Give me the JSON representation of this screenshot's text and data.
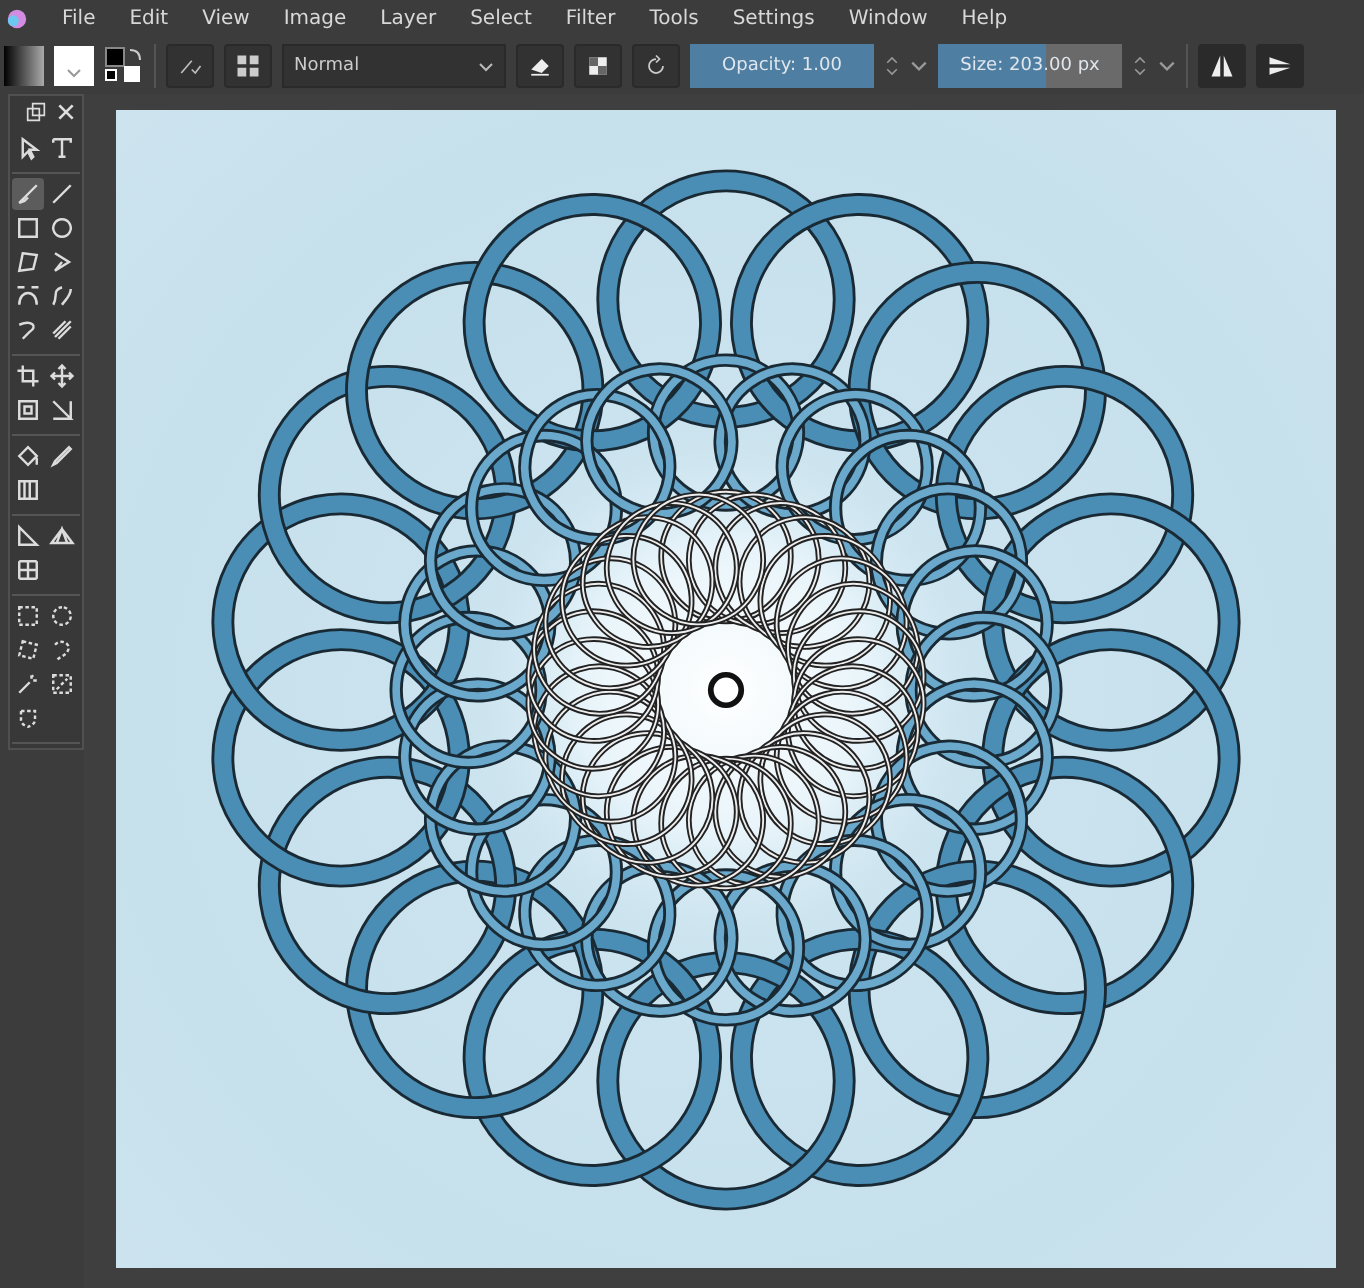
{
  "menu_bar": {
    "menus": [
      "File",
      "Edit",
      "View",
      "Image",
      "Layer",
      "Select",
      "Filter",
      "Tools",
      "Settings",
      "Window",
      "Help"
    ]
  },
  "toolbar": {
    "blend_mode": "Normal",
    "opacity": {
      "text": "Opacity:  1.00",
      "level": 1.0
    },
    "size": {
      "text": "Size:  203.00 px",
      "level": 0.59
    },
    "mirror_horizontal": {
      "on": false
    },
    "mirror_vertical": {
      "on": false
    }
  },
  "toolbox": {
    "groups": [
      [
        {
          "kind": "select",
          "selected": false
        },
        {
          "kind": "text",
          "selected": false
        }
      ],
      [
        {
          "kind": "brush",
          "selected": true
        },
        {
          "kind": "line",
          "selected": false
        },
        {
          "kind": "rect",
          "selected": false
        },
        {
          "kind": "ellipse",
          "selected": false
        },
        {
          "kind": "polygon",
          "selected": false
        },
        {
          "kind": "polyline",
          "selected": false
        },
        {
          "kind": "bezier",
          "selected": false
        },
        {
          "kind": "freepath",
          "selected": false
        },
        {
          "kind": "dynamic",
          "selected": false
        },
        {
          "kind": "multibrush",
          "selected": false
        }
      ],
      [
        {
          "kind": "crop",
          "selected": false
        },
        {
          "kind": "move",
          "selected": false
        },
        {
          "kind": "transform",
          "selected": false
        },
        {
          "kind": "warp",
          "selected": false
        }
      ],
      [
        {
          "kind": "fill",
          "selected": false
        },
        {
          "kind": "picker",
          "selected": false
        },
        {
          "kind": "gradient",
          "selected": false
        }
      ],
      [
        {
          "kind": "measure",
          "selected": false
        },
        {
          "kind": "assistant",
          "selected": false
        },
        {
          "kind": "grid",
          "selected": false
        }
      ],
      [
        {
          "kind": "rectsel",
          "selected": false
        },
        {
          "kind": "ellsel",
          "selected": false
        },
        {
          "kind": "polysel",
          "selected": false
        },
        {
          "kind": "freesel",
          "selected": false
        },
        {
          "kind": "wand",
          "selected": false
        },
        {
          "kind": "similar",
          "selected": false
        },
        {
          "kind": "pathsel",
          "selected": false
        }
      ]
    ]
  }
}
